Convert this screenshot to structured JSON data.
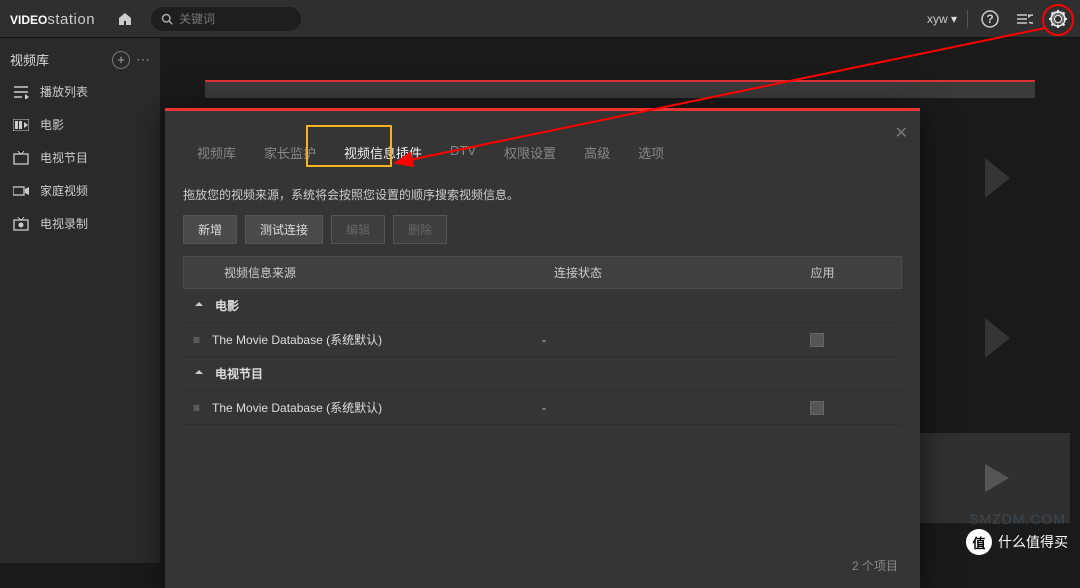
{
  "app_name": {
    "bold": "VIDEO",
    "light": "station"
  },
  "search": {
    "placeholder": "关键词"
  },
  "user": "xyw",
  "sidebar": {
    "header": "视频库",
    "items": [
      {
        "label": "播放列表",
        "icon": "list"
      },
      {
        "label": "电影",
        "icon": "film"
      },
      {
        "label": "电视节目",
        "icon": "tv"
      },
      {
        "label": "家庭视频",
        "icon": "camera"
      },
      {
        "label": "电视录制",
        "icon": "rec"
      }
    ]
  },
  "dialog": {
    "tabs": [
      "视频库",
      "家长监护",
      "视频信息插件",
      "DTV",
      "权限设置",
      "高级",
      "选项"
    ],
    "active_tab": 2,
    "description": "拖放您的视频来源，系统将会按照您设置的顺序搜索视频信息。",
    "buttons": {
      "add": "新增",
      "test": "测试连接",
      "edit": "编辑",
      "delete": "删除"
    },
    "columns": {
      "source": "视频信息来源",
      "status": "连接状态",
      "app": "应用"
    },
    "groups": [
      {
        "label": "电影",
        "rows": [
          {
            "source": "The Movie Database (系统默认)",
            "status": "-",
            "applied": false
          }
        ]
      },
      {
        "label": "电视节目",
        "rows": [
          {
            "source": "The Movie Database (系统默认)",
            "status": "-",
            "applied": false
          }
        ]
      }
    ],
    "footer_count": "2 个项目"
  },
  "watermark": {
    "badge": "值",
    "text": "什么值得买"
  }
}
